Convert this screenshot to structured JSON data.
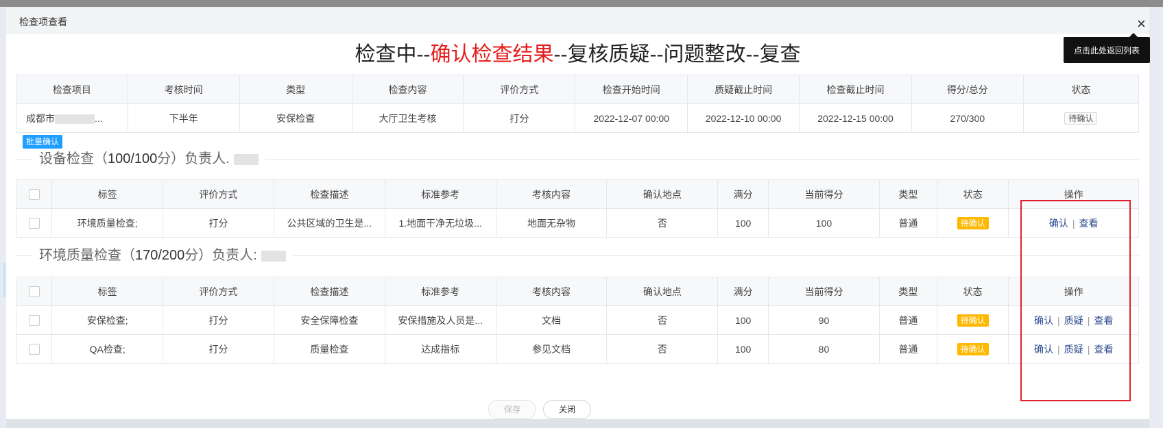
{
  "dialog": {
    "title": "检查项查看",
    "close_icon": "×",
    "tooltip": "点击此处返回列表"
  },
  "workflow": {
    "steps": [
      "检查中",
      "确认检查结果",
      "复核质疑",
      "问题整改",
      "复查"
    ],
    "separator": "--",
    "active_index": 1
  },
  "info_table": {
    "headers": [
      "检查项目",
      "考核时间",
      "类型",
      "检查内容",
      "评价方式",
      "检查开始时间",
      "质疑截止时间",
      "检查截止时间",
      "得分/总分",
      "状态"
    ],
    "row": {
      "project_prefix": "成都市",
      "project_suffix": "...",
      "period": "下半年",
      "type": "安保检查",
      "content": "大厅卫生考核",
      "eval_method": "打分",
      "start_time": "2022-12-07 00:00",
      "dispute_deadline": "2022-12-10 00:00",
      "check_deadline": "2022-12-15 00:00",
      "score": "270/300",
      "status": "待确认"
    }
  },
  "batch_confirm_label": "批量确认",
  "item_headers": [
    "标签",
    "评价方式",
    "检查描述",
    "标准参考",
    "考核内容",
    "确认地点",
    "满分",
    "当前得分",
    "类型",
    "状态",
    "操作"
  ],
  "sections": [
    {
      "label": "设备检查",
      "score": "100/100",
      "score_suffix": "分",
      "owner_label": "负责人.",
      "rows": [
        {
          "tag": "环境质量检查;",
          "eval": "打分",
          "desc": "公共区域的卫生是...",
          "standard": "1.地面干净无垃圾...",
          "content": "地面无杂物",
          "confirm_location": "否",
          "full": "100",
          "current": "100",
          "type": "普通",
          "status": "待确认",
          "ops": [
            "确认",
            "查看"
          ]
        }
      ]
    },
    {
      "label": "环境质量检查",
      "score": "170/200",
      "score_suffix": "分",
      "owner_label": "负责人:",
      "rows": [
        {
          "tag": "安保检查;",
          "eval": "打分",
          "desc": "安全保障检查",
          "standard": "安保措施及人员是...",
          "content": "文档",
          "confirm_location": "否",
          "full": "100",
          "current": "90",
          "type": "普通",
          "status": "待确认",
          "ops": [
            "确认",
            "质疑",
            "查看"
          ]
        },
        {
          "tag": "QA检查;",
          "eval": "打分",
          "desc": "质量检查",
          "standard": "达成指标",
          "content": "参见文档",
          "confirm_location": "否",
          "full": "100",
          "current": "80",
          "type": "普通",
          "status": "待确认",
          "ops": [
            "确认",
            "质疑",
            "查看"
          ]
        }
      ]
    }
  ],
  "footer": {
    "save_label": "保存",
    "close_label": "关闭"
  },
  "colors": {
    "accent_red": "#e51c1c",
    "batch_blue": "#1e9fff",
    "status_badge": "#ffb800",
    "link": "#2b4a8e",
    "highlight_box": "#e0212b"
  }
}
